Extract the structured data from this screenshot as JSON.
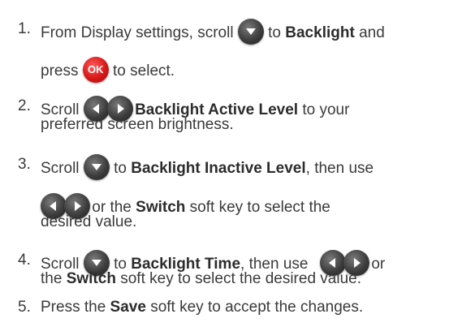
{
  "steps": [
    {
      "num": "1.",
      "l1a": "From Display settings, scroll",
      "l1b": "to",
      "l1c": "Backlight",
      "l1d": "and",
      "l2a": "press",
      "ok": "OK",
      "l2b": "to select."
    },
    {
      "num": "2.",
      "l1a": "Scroll",
      "l1b": "Backlight Active Level",
      "l1c": "to your",
      "l2": "preferred screen brightness."
    },
    {
      "num": "3.",
      "l1a": "Scroll",
      "l1b": "to",
      "l1c": "Backlight Inactive Level",
      "l1d": ", then use",
      "l2a": "or the",
      "l2b": "Switch",
      "l2c": "soft key to select the",
      "l3": "desired value."
    },
    {
      "num": "4.",
      "l1a": "Scroll",
      "l1b": "to",
      "l1c": "Backlight Time",
      "l1d": ", then use",
      "l1e": "or",
      "l2a": "the",
      "l2b": "Switch",
      "l2c": "soft key to select the desired value."
    },
    {
      "num": "5.",
      "l1a": "Press the",
      "l1b": "Save",
      "l1c": "soft key to accept the changes."
    }
  ],
  "icons": {
    "down": "navigation-down-key",
    "ok": "ok-key",
    "left": "navigation-left-key",
    "right": "navigation-right-key"
  }
}
